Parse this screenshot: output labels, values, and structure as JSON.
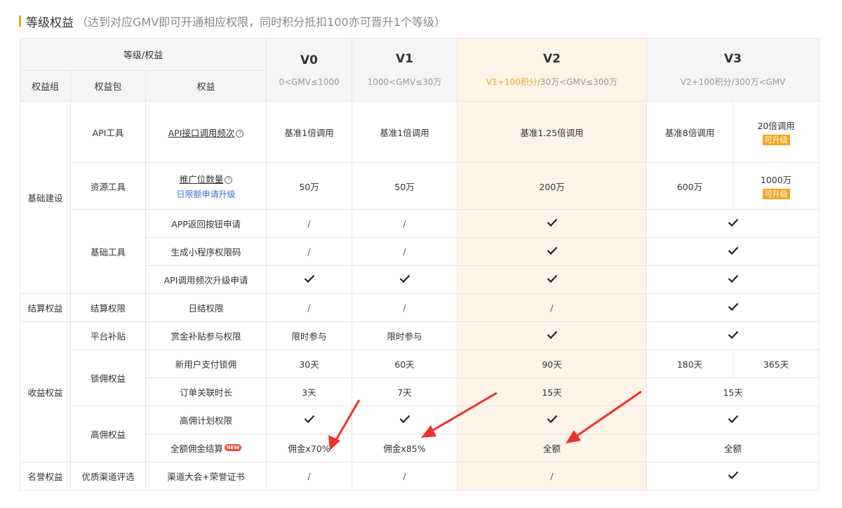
{
  "section": {
    "title": "等级权益",
    "subtitle": "（达到对应GMV即可开通相应权限，同时积分抵扣100亦可晋升1个等级）"
  },
  "header": {
    "group_title": "等级/权益",
    "col_group": "权益组",
    "col_package": "权益包",
    "col_right": "权益",
    "levels": [
      {
        "name": "V0",
        "range": "0<GMV≤1000"
      },
      {
        "name": "V1",
        "range": "1000<GMV≤30万"
      },
      {
        "name": "V2",
        "range_highlight": "V1+100积分",
        "range_rest": "/30万<GMV≤300万"
      },
      {
        "name": "V3",
        "range": "V2+100积分/300万<GMV"
      }
    ]
  },
  "groups": {
    "basic": "基础建设",
    "settle": "结算权益",
    "income": "收益权益",
    "honor": "名誉权益"
  },
  "packages": {
    "api_tool": "API工具",
    "resource_tool": "资源工具",
    "basic_tool": "基础工具",
    "settle_right": "结算权限",
    "subsidy": "平台补贴",
    "commission": "锁佣权益",
    "high_comm": "高佣权益",
    "channel": "优质渠道评选"
  },
  "rows": {
    "api_freq": {
      "label": "API接口调用频次",
      "v0": "基准1倍调用",
      "v1": "基准1倍调用",
      "v2": "基准1.25倍调用",
      "v3a": "基准8倍调用",
      "v3b": "20倍调用",
      "v3b_badge": "可升级"
    },
    "ad_slot": {
      "label": "推广位数量",
      "link": "日限额申请升级",
      "v0": "50万",
      "v1": "50万",
      "v2": "200万",
      "v3a": "600万",
      "v3b": "1000万",
      "v3b_badge": "可升级"
    },
    "app_back": {
      "label": "APP返回按钮申请",
      "v0": "/",
      "v1": "/"
    },
    "mini_code": {
      "label": "生成小程序权限码",
      "v0": "/",
      "v1": "/"
    },
    "api_upgrade": {
      "label": "API调用频次升级申请"
    },
    "daily_settle": {
      "label": "日结权限",
      "v0": "/",
      "v1": "/",
      "v2": "/"
    },
    "bounty": {
      "label": "赏金补贴参与权限",
      "v0": "限时参与",
      "v1": "限时参与"
    },
    "new_user": {
      "label": "新用户支付锁佣",
      "v0": "30天",
      "v1": "60天",
      "v2": "90天",
      "v3a": "180天",
      "v3b": "365天"
    },
    "order_link": {
      "label": "订单关联时长",
      "v0": "3天",
      "v1": "7天",
      "v2": "15天",
      "v3": "15天"
    },
    "high_plan": {
      "label": "高佣计划权限"
    },
    "full_settle": {
      "label": "全额佣金结算",
      "badge": "NEW",
      "v0": "佣金x70%",
      "v1": "佣金x85%",
      "v2": "全额",
      "v3": "全额"
    },
    "conference": {
      "label": "渠道大会+荣誉证书",
      "v0": "/",
      "v1": "/",
      "v2": "/"
    }
  },
  "icons": {
    "check": "check-icon",
    "question": "question-circle-icon",
    "arrow": "red-arrow-icon"
  },
  "colors": {
    "accent": "#f59a23",
    "highlight_bg": "#fdf3e6",
    "link": "#3a6fd8",
    "badge": "#f5a623",
    "arrow": "#f0302a"
  }
}
